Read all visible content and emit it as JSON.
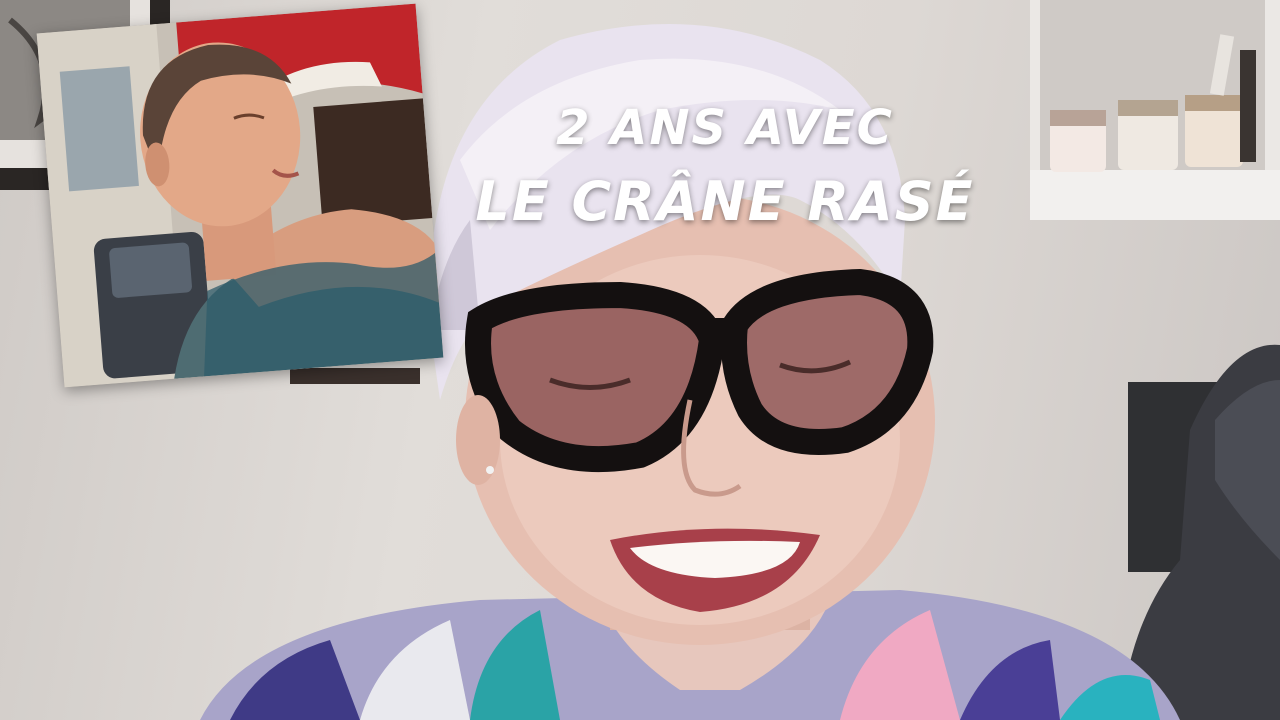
{
  "overlay": {
    "line1": "2 ANS AVEC",
    "line2": "LE CRÂNE RASÉ"
  },
  "colors": {
    "text": "#ffffff",
    "wall": "#dcd7d3",
    "hair": "#e9e3ef",
    "glasses": "#141010",
    "awning": "#c0252a"
  }
}
